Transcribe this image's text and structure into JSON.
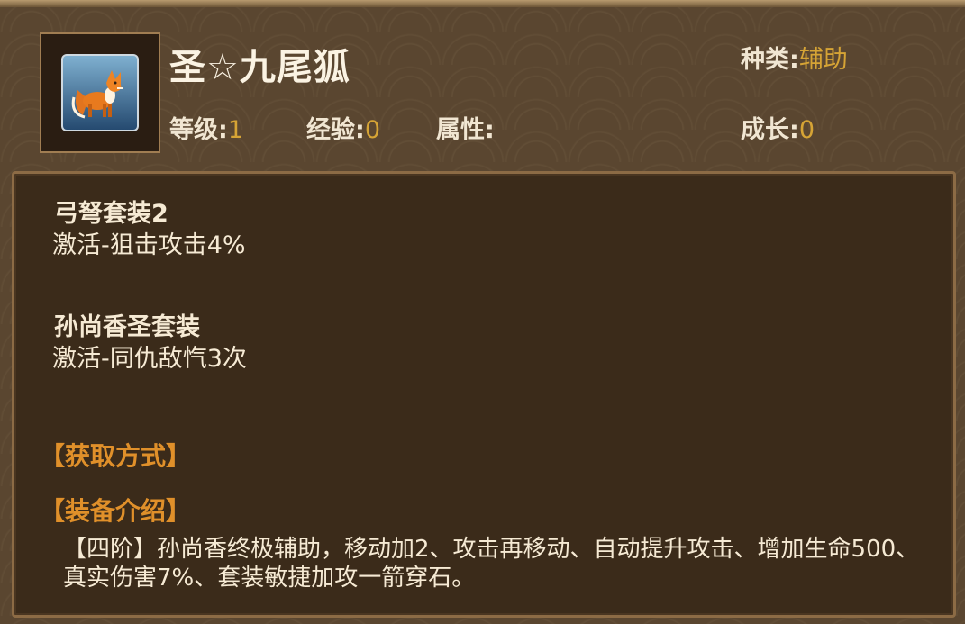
{
  "item": {
    "name": "圣☆九尾狐",
    "icon": "nine-tailed-fox-icon"
  },
  "stats": {
    "type_label": "种类:",
    "type_value": "辅助",
    "level_label": "等级:",
    "level_value": "1",
    "exp_label": "经验:",
    "exp_value": "0",
    "attr_label": "属性:",
    "attr_value": "",
    "growth_label": "成长:",
    "growth_value": "0"
  },
  "sets": [
    {
      "title": "弓弩套装2",
      "effect": "激活-狙击攻击4%"
    },
    {
      "title": "孙尚香圣套装",
      "effect": "激活-同仇敌忾3次"
    }
  ],
  "sections": {
    "obtain_heading": "【获取方式】",
    "intro_heading": "【装备介绍】",
    "intro_text": "【四阶】孙尚香终极辅助，移动加2、攻击再移动、自动提升攻击、增加生命500、真实伤害7%、套装敏捷加攻一箭穿石。"
  },
  "colors": {
    "accent_gold": "#d6a435",
    "section_orange": "#e0902a",
    "background": "#5a4630",
    "panel": "#3b2b1a"
  }
}
